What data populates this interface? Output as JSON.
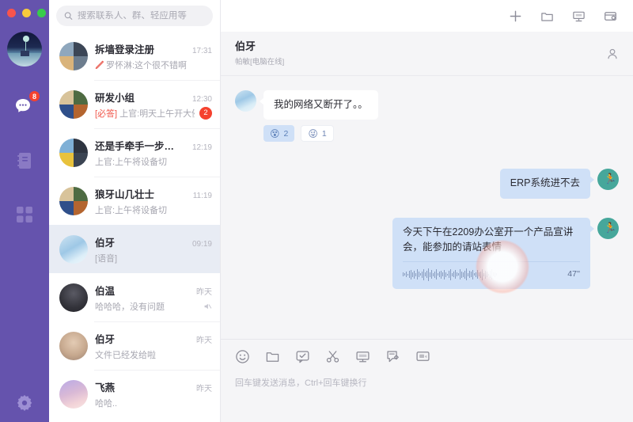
{
  "window": {
    "traffic_lights": [
      "close",
      "minimize",
      "zoom"
    ]
  },
  "rail": {
    "avatar_name": "user-avatar",
    "items": [
      {
        "name": "chats",
        "icon": "chat-bubble-icon",
        "badge": "8"
      },
      {
        "name": "contacts",
        "icon": "address-book-icon",
        "badge": ""
      },
      {
        "name": "apps",
        "icon": "apps-grid-icon",
        "badge": ""
      }
    ],
    "settings_icon": "gear-icon"
  },
  "search": {
    "placeholder": "搜索联系人、群、轻应用等",
    "value": "",
    "icon": "search-icon"
  },
  "titlebar_actions": [
    {
      "name": "add",
      "icon": "plus-icon"
    },
    {
      "name": "files",
      "icon": "folder-icon"
    },
    {
      "name": "meeting",
      "icon": "projector-icon"
    },
    {
      "name": "workbench",
      "icon": "card-settings-icon"
    }
  ],
  "conversations": [
    {
      "name": "拆墙登录注册",
      "time": "17:31",
      "preview": "罗怀淋:这个很不错啊",
      "draft_icon": "draft-pencil-icon",
      "badge": "",
      "muted": false,
      "active": false,
      "avatar_colors": [
        "#8fa7bd",
        "#3c4656",
        "#d9b37a",
        "#6d7d8e"
      ]
    },
    {
      "name": "研发小组",
      "time": "12:30",
      "preview_tag": "[必答]",
      "preview": "上官:明天上午开大例会",
      "badge": "2",
      "muted": false,
      "active": false,
      "avatar_colors": [
        "#d8c39a",
        "#4e6b42",
        "#2f4f8a",
        "#b4652f"
      ]
    },
    {
      "name": "还是手牵手一步…",
      "time": "12:19",
      "preview": "上官:上午将设备切",
      "badge": "",
      "muted": false,
      "active": false,
      "avatar_colors": [
        "#7fb0d6",
        "#2e3440",
        "#e8c23c",
        "#3b4452"
      ]
    },
    {
      "name": "狼牙山几壮士",
      "time": "11:19",
      "preview": "上官:上午将设备切",
      "badge": "",
      "muted": false,
      "active": false,
      "avatar_colors": [
        "#d8c39a",
        "#4e6b42",
        "#2f4f8a",
        "#b4652f"
      ]
    },
    {
      "name": "伯牙",
      "time": "09:19",
      "preview": "[语音]",
      "badge": "",
      "muted": false,
      "active": true,
      "avatar_colors": [
        "#bfdff0",
        "#9ec8e6",
        "#dceef8",
        "#eef6fb"
      ]
    },
    {
      "name": "伯温",
      "time": "昨天",
      "preview": "哈哈哈，没有问题",
      "badge": "",
      "muted": true,
      "active": false,
      "avatar_colors": [
        "#3b3b41",
        "#2b2b31",
        "#50505a",
        "#3f3f47"
      ]
    },
    {
      "name": "伯牙",
      "time": "昨天",
      "preview": "文件已经发给啦",
      "badge": "",
      "muted": false,
      "active": false,
      "avatar_colors": [
        "#cbb39c",
        "#8f7a66",
        "#ddc9b5",
        "#a79182"
      ]
    },
    {
      "name": "飞燕",
      "time": "昨天",
      "preview": "哈哈..",
      "badge": "",
      "muted": false,
      "active": false,
      "avatar_colors": [
        "#c9b6e8",
        "#e7c3cf",
        "#9f8fd1",
        "#f0d6dd"
      ]
    }
  ],
  "chat": {
    "title": "伯牙",
    "subtitle": "帕敏[电脑在线]",
    "profile_icon": "person-icon",
    "messages": [
      {
        "direction": "in",
        "text": "我的网络又断开了。。",
        "reactions": [
          {
            "emoji": "😵",
            "count": "2",
            "selected": true
          },
          {
            "emoji": "😜",
            "count": "1",
            "selected": false
          }
        ]
      },
      {
        "direction": "out",
        "text": "ERP系统进不去",
        "reactions": []
      },
      {
        "direction": "out",
        "text": "今天下午在2209办公室开一个产品宣讲会，能参加的请站表情",
        "voice": {
          "duration": "47''",
          "icon": "waveform-icon"
        },
        "reactions": []
      }
    ]
  },
  "composer": {
    "tools": [
      {
        "name": "emoji",
        "icon": "smiley-icon"
      },
      {
        "name": "file",
        "icon": "folder-icon"
      },
      {
        "name": "approval",
        "icon": "checkbox-message-icon"
      },
      {
        "name": "screenshot",
        "icon": "scissors-icon"
      },
      {
        "name": "screen-share",
        "icon": "monitor-icon"
      },
      {
        "name": "task",
        "icon": "checklist-icon"
      },
      {
        "name": "video",
        "icon": "video-card-icon"
      }
    ],
    "hint": "回车键发送消息，Ctrl+回车键换行"
  },
  "colors": {
    "rail": "#6553ad",
    "accent_bubble": "#cfe0f7",
    "badge": "#f5412e",
    "active_row": "#e8ecf4"
  }
}
